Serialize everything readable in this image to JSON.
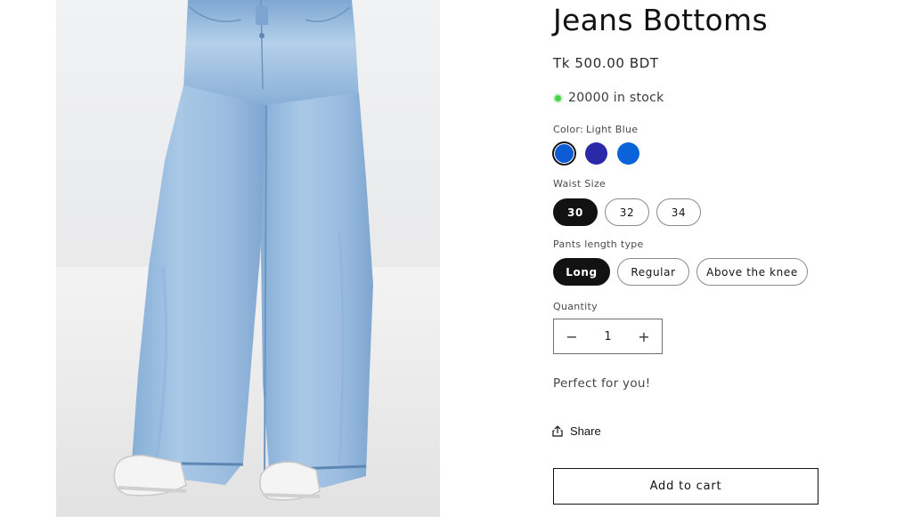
{
  "product": {
    "title": "Jeans Bottoms",
    "price": "Tk 500.00 BDT",
    "stock": "20000 in stock",
    "stock_status_color": "#4ad04f",
    "image_alt": "Light blue wide-leg jeans worn with white sneakers"
  },
  "color_option": {
    "label": "Color:",
    "selected": "Light Blue",
    "swatches": [
      {
        "color": "#0d5bd4",
        "selected": true
      },
      {
        "color": "#2a2aa8",
        "selected": false
      },
      {
        "color": "#0a63d8",
        "selected": false
      }
    ]
  },
  "waist_option": {
    "label": "Waist Size",
    "options": [
      "30",
      "32",
      "34"
    ],
    "selected": "30"
  },
  "length_option": {
    "label": "Pants length type",
    "options": [
      "Long",
      "Regular",
      "Above the knee"
    ],
    "selected": "Long"
  },
  "quantity": {
    "label": "Quantity",
    "value": "1",
    "decrease_symbol": "−",
    "increase_symbol": "+"
  },
  "description": "Perfect for you!",
  "share": {
    "label": "Share",
    "icon": "share-icon"
  },
  "cart": {
    "button_label": "Add to cart"
  }
}
